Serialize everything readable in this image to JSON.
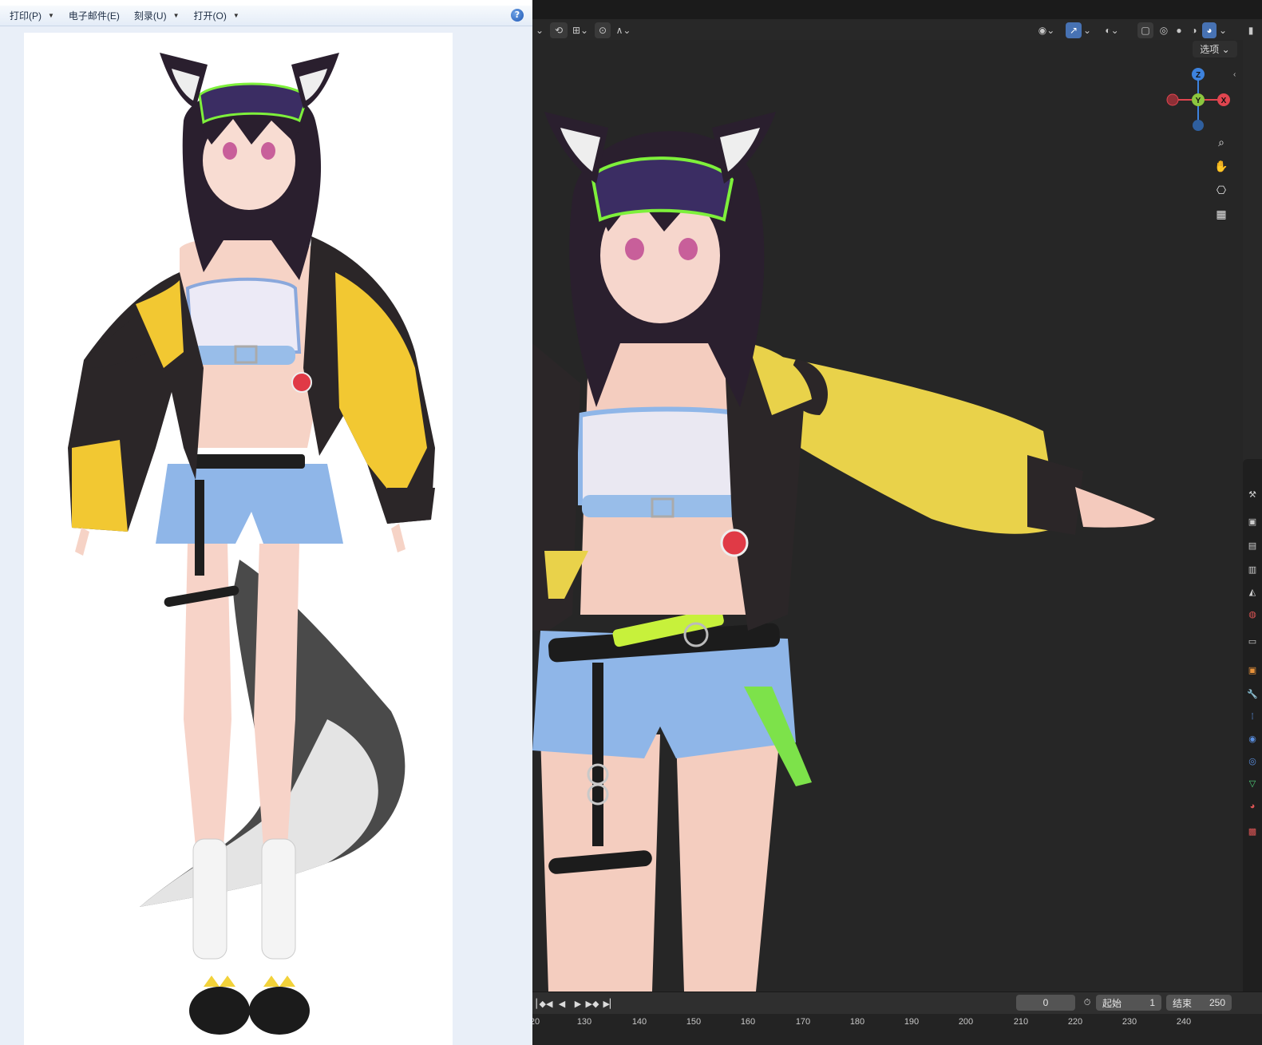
{
  "viewer": {
    "menu": [
      {
        "label": "打印(P)",
        "icon": "caret-down-icon"
      },
      {
        "label": "电子邮件(E)"
      },
      {
        "label": "刻录(U)",
        "icon": "caret-down-icon"
      },
      {
        "label": "打开(O)",
        "icon": "caret-down-icon"
      }
    ],
    "help_icon": "help-icon",
    "help_glyph": "?"
  },
  "blender": {
    "options_label": "选项",
    "gizmo_axes": [
      "Z",
      "Y",
      "X"
    ],
    "axis_colors": {
      "x": "#e0454f",
      "y": "#8cc63e",
      "z": "#3d82dd"
    },
    "nav_tools": [
      "zoom-icon",
      "pan-hand-icon",
      "camera-icon",
      "ortho-grid-icon"
    ],
    "timeline": {
      "current_frame": "0",
      "start_label": "起始",
      "start_value": "1",
      "end_label": "结束",
      "end_value": "250",
      "ruler": [
        "20",
        "130",
        "140",
        "150",
        "160",
        "170",
        "180",
        "190",
        "200",
        "210",
        "220",
        "230",
        "240"
      ]
    },
    "colors": {
      "accent": "#4772b3",
      "viewport_bg": "#262626"
    }
  }
}
